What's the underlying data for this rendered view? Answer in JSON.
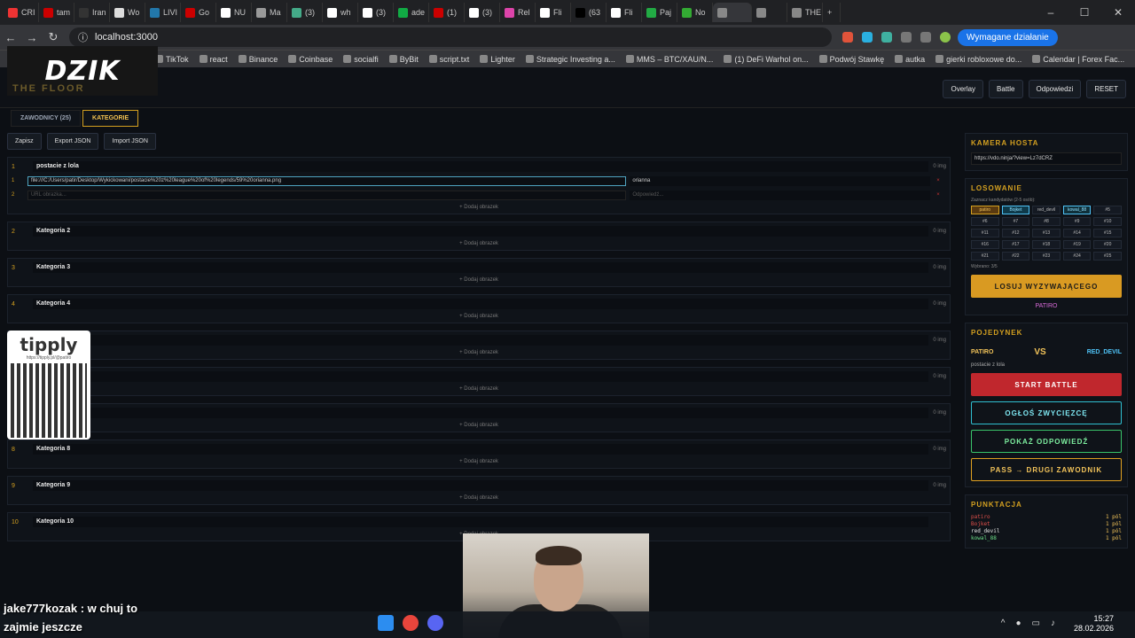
{
  "browser": {
    "tabs": [
      "CRI",
      "tam",
      "Iran",
      "Wo",
      "LIVI",
      "Go",
      "NU",
      "Ma",
      "(3)",
      "wh",
      "(3)",
      "ade",
      "(1)",
      "(3)",
      "Rel",
      "Fli",
      "(63",
      "Fli",
      "Paj",
      "No",
      "",
      "",
      "THE"
    ],
    "url": "localhost:3000",
    "required_action": "Wymagane działanie",
    "bookmarks": [
      "TikTok",
      "react",
      "Binance",
      "Coinbase",
      "socialfi",
      "ByBit",
      "script.txt",
      "Lighter",
      "Strategic Investing a...",
      "MMS – BTC/XAU/N...",
      "(1) DeFi Warhol on...",
      "Podwój Stawkę",
      "autka",
      "gierki robloxowe do...",
      "Calendar | Forex Fac..."
    ]
  },
  "app": {
    "logo": "DZIK",
    "logo_sub": "THE FLOOR",
    "top_buttons": {
      "overlay": "Overlay",
      "battle": "Battle",
      "answers": "Odpowiedzi",
      "reset": "RESET"
    },
    "tabs": {
      "players": "ZAWODNICY (25)",
      "categories": "KATEGORIE"
    },
    "actions": {
      "save": "Zapisz",
      "export": "Export JSON",
      "import": "Import JSON"
    },
    "categories": [
      {
        "num": "1",
        "name": "postacie z lola",
        "count": "0 img",
        "rows": [
          {
            "num": "1",
            "url": "file:///C:/Users/patir/Desktop/Wykickowani/postacie%20z%20league%20of%20legends/59%20orianna.png",
            "answer": "orianna"
          },
          {
            "num": "2",
            "url": "URL obrazka...",
            "answer": "Odpowiedź..."
          }
        ]
      },
      {
        "num": "2",
        "name": "Kategoria 2",
        "count": "0 img"
      },
      {
        "num": "3",
        "name": "Kategoria 3",
        "count": "0 img"
      },
      {
        "num": "4",
        "name": "Kategoria 4",
        "count": "0 img"
      },
      {
        "num": "5",
        "name": "",
        "count": "0 img"
      },
      {
        "num": "6",
        "name": "",
        "count": "0 img"
      },
      {
        "num": "7",
        "name": "Kategoria 7",
        "count": "0 img"
      },
      {
        "num": "8",
        "name": "Kategoria 8",
        "count": "0 img"
      },
      {
        "num": "9",
        "name": "Kategoria 9",
        "count": "0 img"
      },
      {
        "num": "10",
        "name": "Kategoria 10",
        "count": ""
      }
    ],
    "add_image": "+ Dodaj obrazek",
    "host_camera": {
      "title": "KAMERA HOSTA",
      "url": "https://vdo.ninja/?view=Lz7dCRZ"
    },
    "draw": {
      "title": "LOSOWANIE",
      "hint": "Zaznacz kandydatów (2-5 osób):",
      "cells": [
        "patiro",
        "Bojket",
        "red_devil",
        "kowal_88",
        "#5",
        "#6",
        "#7",
        "#8",
        "#9",
        "#10",
        "#11",
        "#12",
        "#13",
        "#14",
        "#15",
        "#16",
        "#17",
        "#18",
        "#19",
        "#20",
        "#21",
        "#22",
        "#23",
        "#24",
        "#25"
      ],
      "selected": "Wybrano: 3/5",
      "button": "LOSUJ WYZYWAJĄCEGO",
      "result": "PATIRO"
    },
    "duel": {
      "title": "POJEDYNEK",
      "p1": "PATIRO",
      "vs": "VS",
      "p2": "RED_DEVIL",
      "category": "postacie z lola",
      "start": "START BATTLE",
      "announce": "OGŁOŚ ZWYCIĘZCĘ",
      "show": "POKAŻ ODPOWIEDŹ",
      "pass": "PASS → DRUGI ZAWODNIK"
    },
    "scores": {
      "title": "PUNKTACJA",
      "rows": [
        {
          "name": "patiro",
          "pts": "1 pól",
          "color": "#e0504a"
        },
        {
          "name": "Bojket",
          "pts": "1 pól",
          "color": "#e0504a"
        },
        {
          "name": "red_devil",
          "pts": "1 pól",
          "color": "#e8e8e8"
        },
        {
          "name": "kowal_88",
          "pts": "1 pól",
          "color": "#6ee08a"
        }
      ]
    }
  },
  "overlay": {
    "tipply": "tipply",
    "tipply_url": "https://tipply.pl/@patiro",
    "chat1": "jake777kozak : w chuj to",
    "chat2": "zajmie jeszcze"
  },
  "system": {
    "time": "15:27",
    "date": "28.02.2026"
  }
}
